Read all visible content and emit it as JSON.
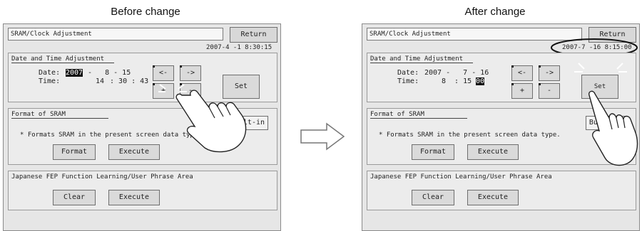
{
  "captions": {
    "before": "Before change",
    "after": "After change"
  },
  "before": {
    "title": "SRAM/Clock Adjustment",
    "return_label": "Return",
    "clock": "2007-4 -1   8:30:15",
    "datetime_title": "Date and Time Adjustment",
    "date_label": "Date:",
    "date_year": "2007",
    "date_rest": " -   8 - 15",
    "time_label": "Time:",
    "time_hour": "14",
    "time_rest": " : 30 : 43",
    "btn_left": "<-",
    "btn_right": "->",
    "btn_plus": "+",
    "btn_minus": "-",
    "set_label": "Set",
    "sram_title": "Format of SRAM",
    "builtin_label": "Built-in",
    "sram_note": "* Formats SRAM in the present screen data type.",
    "format_label": "Format",
    "execute_label": "Execute",
    "fep_title": "Japanese FEP Function Learning/User Phrase Area",
    "clear_label": "Clear",
    "execute2_label": "Execute"
  },
  "after": {
    "title": "SRAM/Clock Adjustment",
    "return_label": "Return",
    "clock": "2007-7 -16   8:15:00",
    "datetime_title": "Date and Time Adjustment",
    "date_label": "Date:",
    "date_text": "2007 -   7 - 16",
    "time_label": "Time:",
    "time_text": "8  : 15 :",
    "time_sec": "00",
    "btn_left": "<-",
    "btn_right": "->",
    "btn_plus": "+",
    "btn_minus": "-",
    "set_label": "Set",
    "sram_title": "Format of SRAM",
    "builtin_label": "Built-in",
    "sram_note": "* Formats SRAM in the present screen data type.",
    "format_label": "Format",
    "execute_label": "Execute",
    "fep_title": "Japanese FEP Function Learning/User Phrase Area",
    "clear_label": "Clear",
    "execute2_label": "Execute"
  }
}
